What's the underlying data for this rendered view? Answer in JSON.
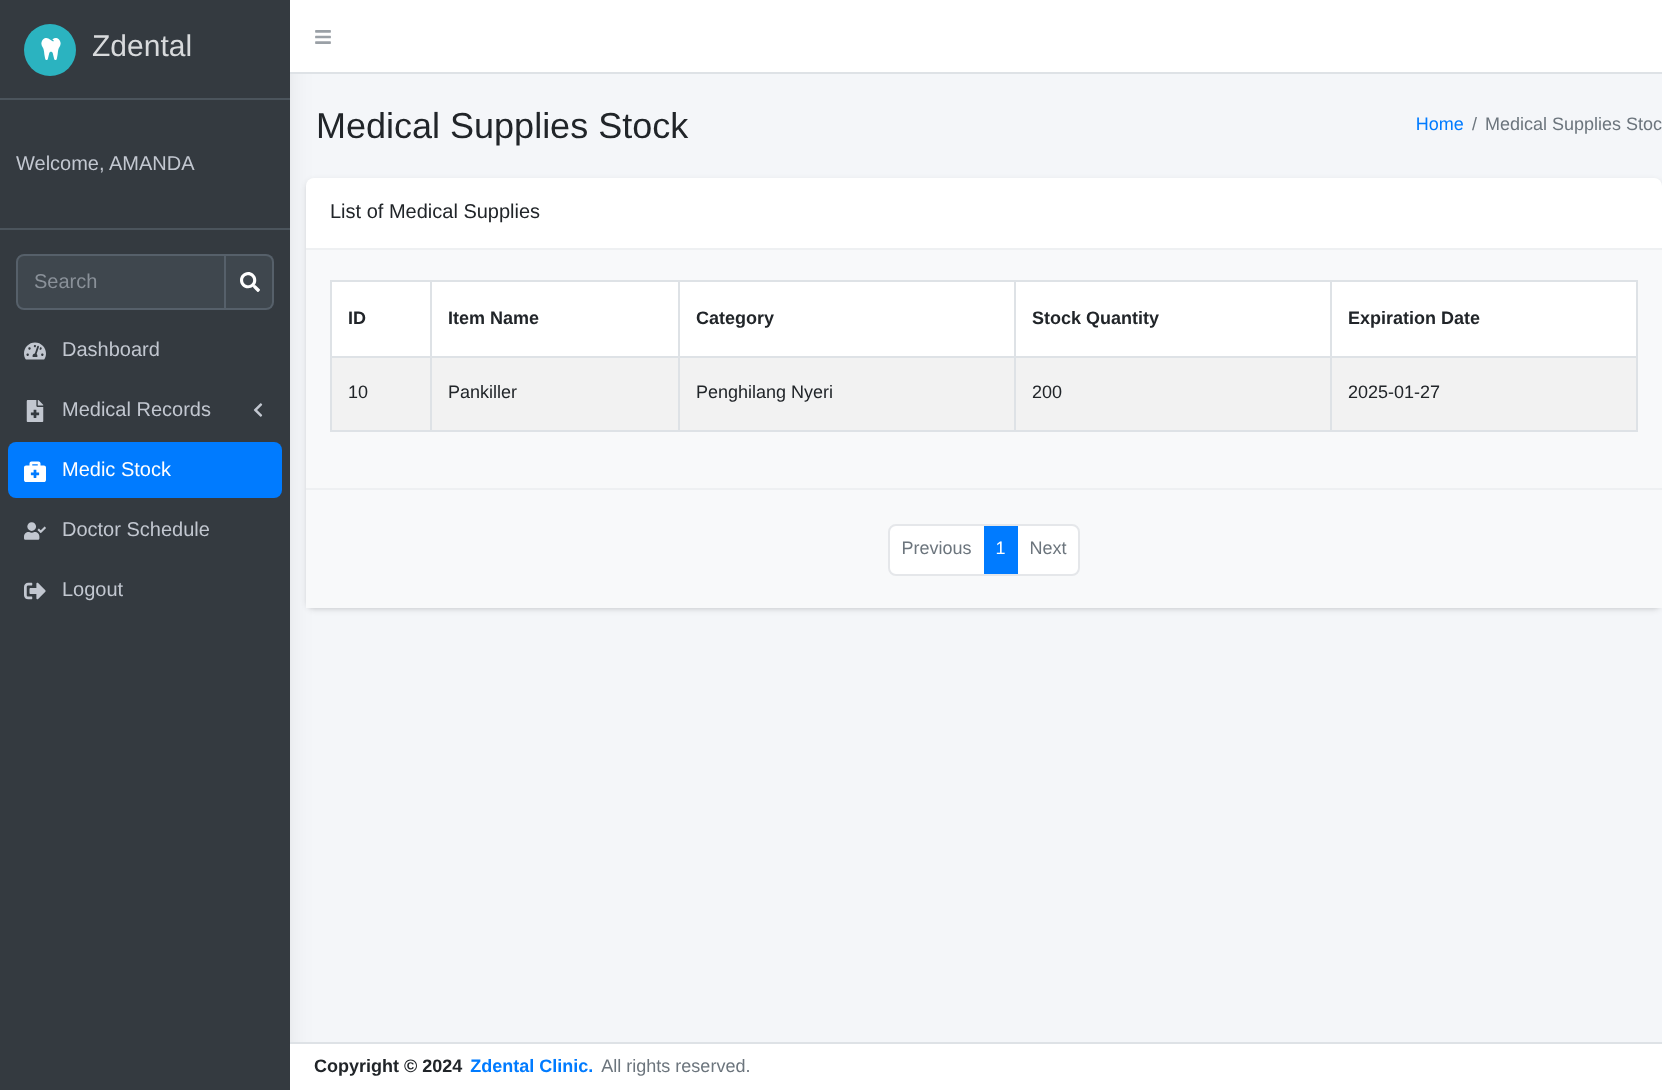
{
  "brand": {
    "name": "Zdental"
  },
  "sidebar": {
    "welcome": "Welcome, AMANDA",
    "search": {
      "placeholder": "Search"
    },
    "items": [
      {
        "label": "Dashboard",
        "selected": false,
        "has_submenu": false
      },
      {
        "label": "Medical Records",
        "selected": false,
        "has_submenu": true
      },
      {
        "label": "Medic Stock",
        "selected": true,
        "has_submenu": false
      },
      {
        "label": "Doctor Schedule",
        "selected": false,
        "has_submenu": false
      },
      {
        "label": "Logout",
        "selected": false,
        "has_submenu": false
      }
    ]
  },
  "page": {
    "title": "Medical Supplies Stock",
    "breadcrumb": [
      {
        "label": "Home",
        "link": true
      },
      {
        "label": "Medical Supplies Stoc",
        "link": false
      }
    ],
    "breadcrumb_separator": "/"
  },
  "card": {
    "title": "List of Medical Supplies",
    "table": {
      "columns": [
        "ID",
        "Item Name",
        "Category",
        "Stock Quantity",
        "Expiration Date"
      ],
      "rows": [
        [
          "10",
          "Pankiller",
          "Penghilang Nyeri",
          "200",
          "2025-01-27"
        ]
      ]
    },
    "pagination": [
      {
        "label": "Previous",
        "selected": false
      },
      {
        "label": "1",
        "selected": true
      },
      {
        "label": "Next",
        "selected": false
      }
    ]
  },
  "footer": {
    "prefix": "Copyright © 2024",
    "link": "Zdental Clinic.",
    "suffix": "All rights reserved."
  }
}
